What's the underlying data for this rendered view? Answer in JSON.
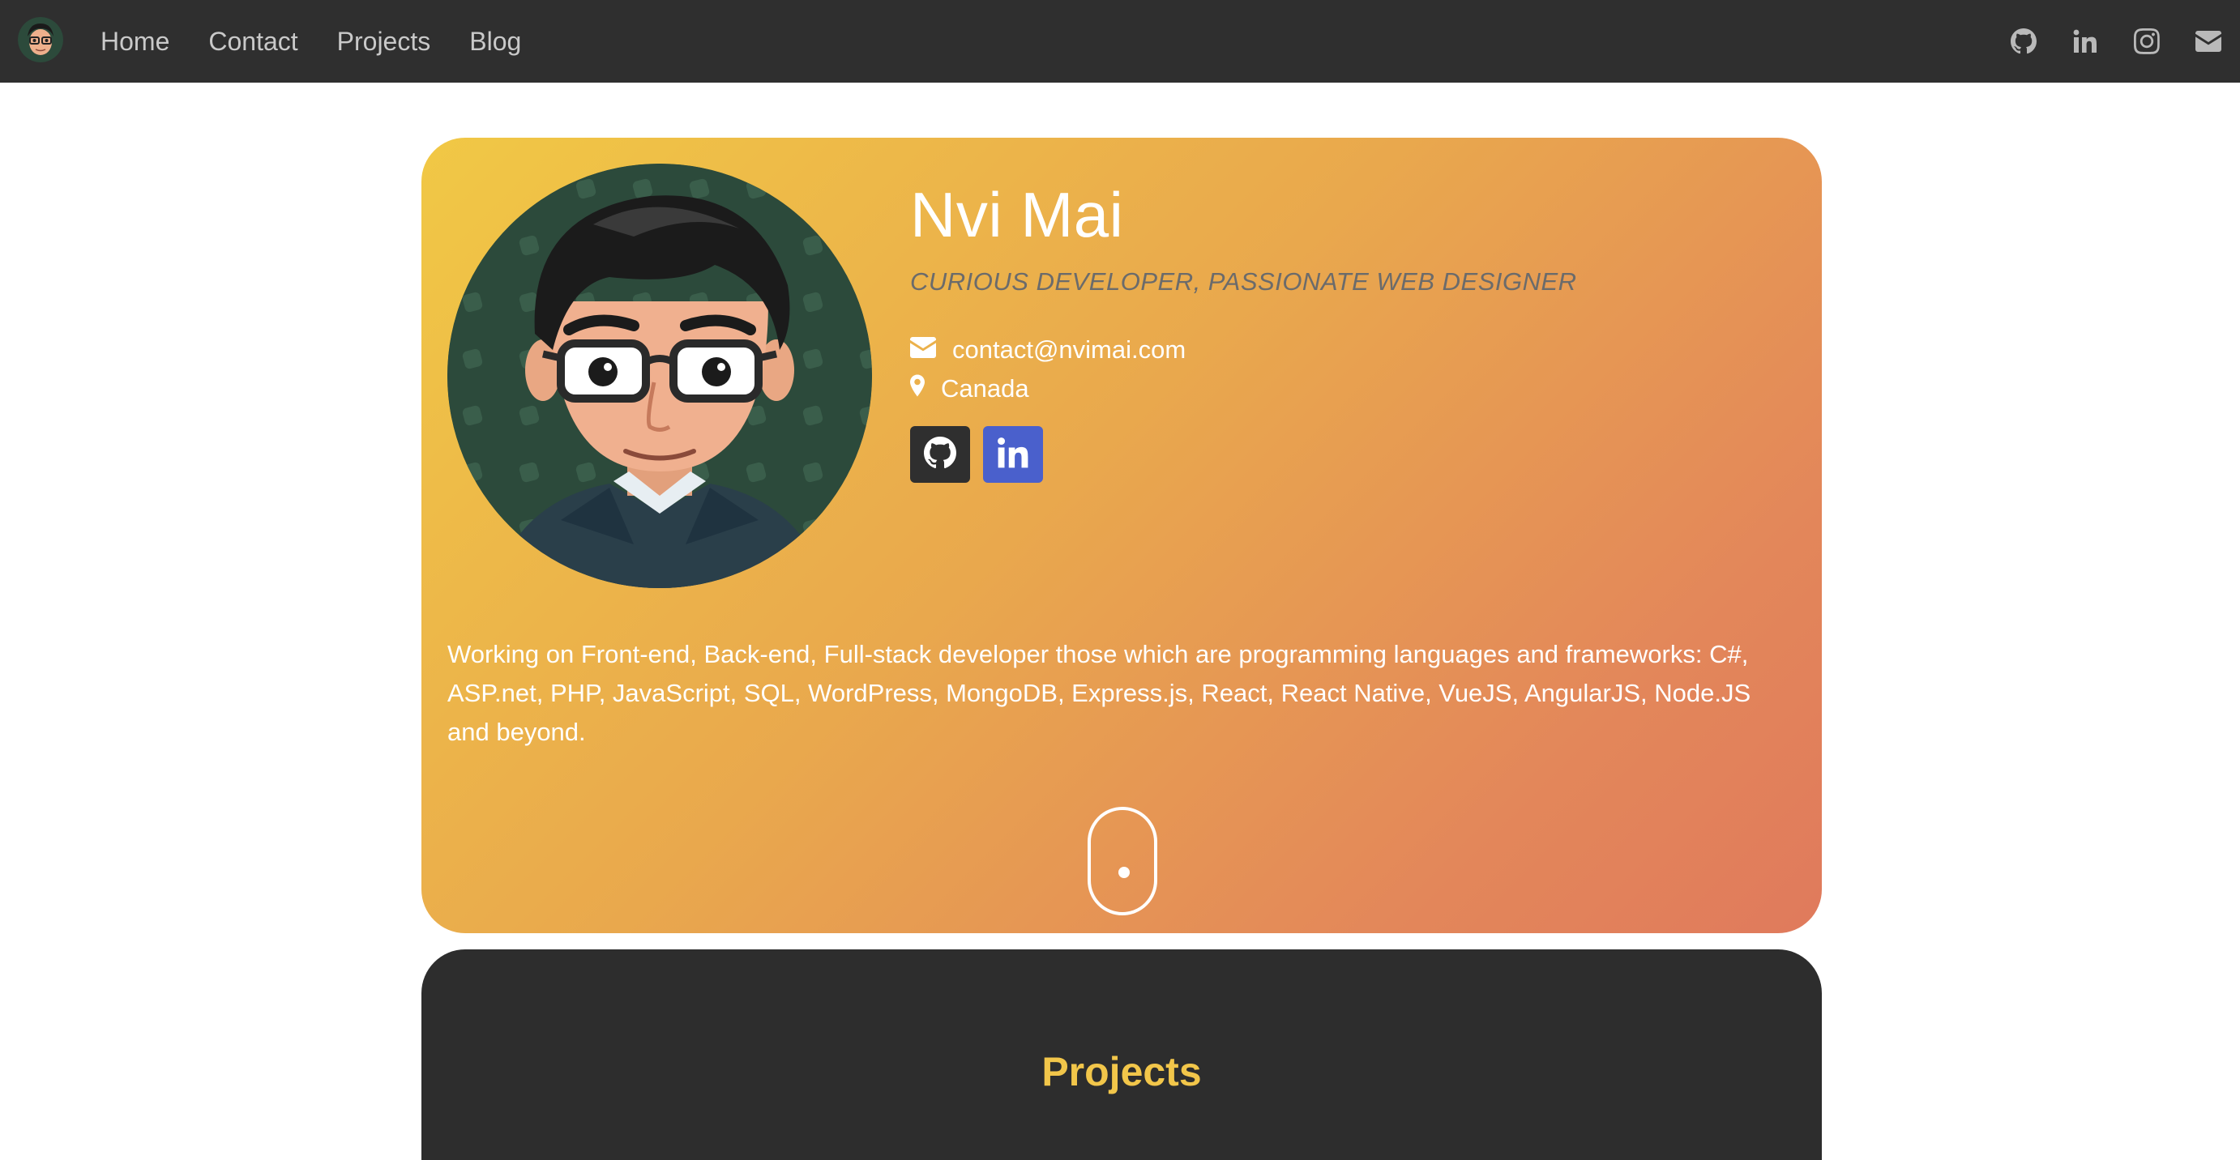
{
  "nav": {
    "links": [
      "Home",
      "Contact",
      "Projects",
      "Blog"
    ],
    "social_icons": [
      "github-icon",
      "linkedin-icon",
      "instagram-icon",
      "email-icon"
    ],
    "background": "#2f2f2f"
  },
  "hero": {
    "name": "Nvi Mai",
    "tagline": "CURIOUS DEVELOPER, PASSIONATE WEB DESIGNER",
    "email": "contact@nvimai.com",
    "location": "Canada",
    "badges": [
      "github-icon",
      "linkedin-icon"
    ],
    "description": "Working on Front-end, Back-end, Full-stack developer those which are programming languages and frameworks: C#, ASP.net, PHP, JavaScript, SQL, WordPress, MongoDB, Express.js, React, React Native, VueJS, AngularJS, Node.JS and beyond.",
    "gradient_start": "#f1c845",
    "gradient_end": "#e07a5c"
  },
  "projects": {
    "title": "Projects",
    "title_color": "#f2c64a",
    "background": "#2d2d2d"
  }
}
